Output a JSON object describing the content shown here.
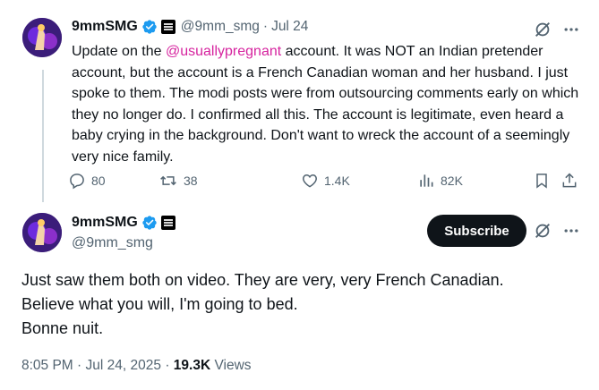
{
  "colors": {
    "text": "#0f1419",
    "secondary": "#536471",
    "mention": "#d6249f",
    "verified": "#1d9bf0",
    "button": "#0f1419"
  },
  "reply_tweet": {
    "display_name": "9mmSMG",
    "handle": "@9mm_smg",
    "separator": "·",
    "date": "Jul 24",
    "text_before_mention": "Update on the ",
    "mention": "@usuallypregnant",
    "text_after_mention": " account. It was NOT an Indian pretender account, but the account is a French Canadian woman and her husband. I just spoke to them. The modi posts were from outsourcing comments early on which they no longer do. I confirmed all this. The account is legitimate, even heard a baby crying in the background. Don't want to wreck the account of a seemingly very nice family.",
    "actions": {
      "replies": "80",
      "reposts": "38",
      "likes": "1.4K",
      "views": "82K"
    },
    "icons": [
      "grok-icon",
      "more-icon",
      "reply-icon",
      "repost-icon",
      "like-icon",
      "views-icon",
      "bookmark-icon",
      "share-icon"
    ]
  },
  "main_tweet": {
    "display_name": "9mmSMG",
    "handle": "@9mm_smg",
    "subscribe_label": "Subscribe",
    "lines": [
      "Just saw them both on video. They are very, very French Canadian.",
      "Believe what you will, I'm going to bed.",
      "Bonne nuit."
    ],
    "time": "8:05 PM",
    "date": "Jul 24, 2025",
    "separator": "·",
    "views_count": "19.3K",
    "views_label": "Views"
  }
}
